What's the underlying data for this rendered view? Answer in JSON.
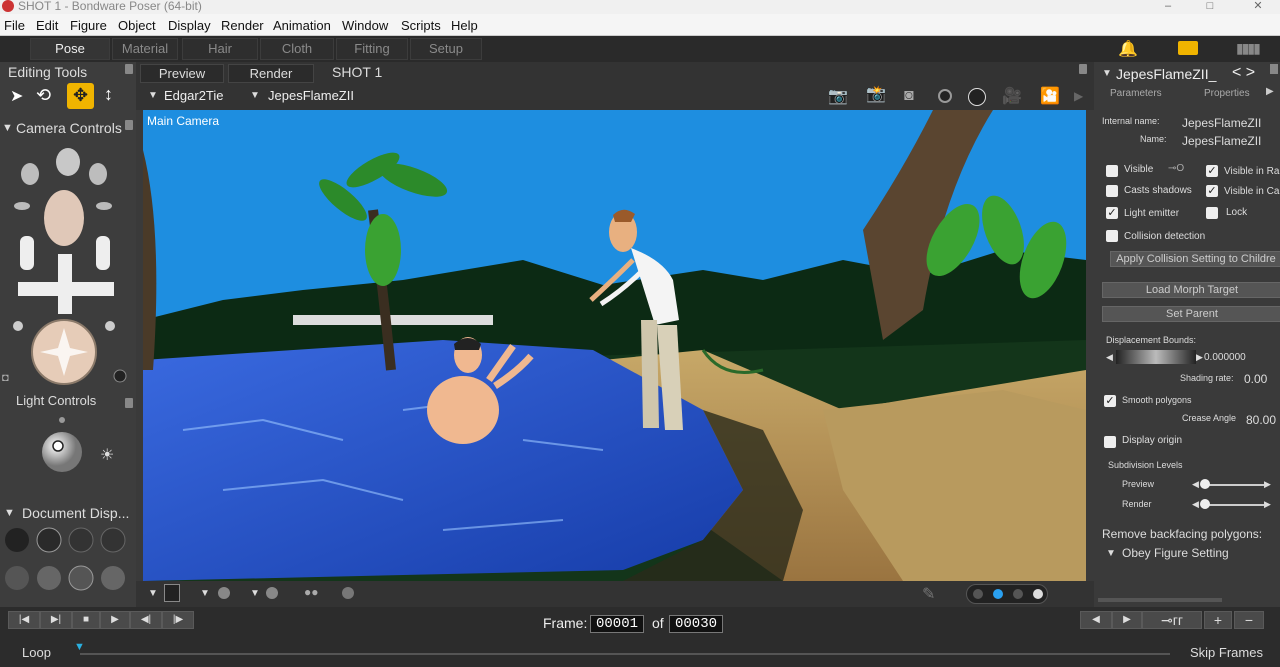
{
  "window": {
    "title": "SHOT 1 - Bondware Poser (64-bit)"
  },
  "menu": [
    "File",
    "Edit",
    "Figure",
    "Object",
    "Display",
    "Render",
    "Animation",
    "Window",
    "Scripts",
    "Help"
  ],
  "rooms": [
    "Pose",
    "Material",
    "Hair",
    "Cloth",
    "Fitting",
    "Setup"
  ],
  "left": {
    "editing_tools": "Editing Tools",
    "camera_controls": "Camera Controls",
    "light_controls": "Light Controls",
    "document_display": "Document  Disp..."
  },
  "viewport": {
    "tabs": [
      "Preview",
      "Render"
    ],
    "shot": "SHOT 1",
    "figure_select": "Edgar2Tie",
    "actor_select": "JepesFlameZII",
    "camera_label": "Main Camera"
  },
  "right": {
    "title": "JepesFlameZII_",
    "tabs": [
      "Parameters",
      "Properties"
    ],
    "internal_name_label": "Internal name:",
    "internal_name": "JepesFlameZII",
    "name_label": "Name:",
    "name": "JepesFlameZII",
    "visible": "Visible",
    "visible_in_raytracing": "Visible in Ra",
    "casts_shadows": "Casts shadows",
    "visible_in_camera": "Visible in Ca",
    "light_emitter": "Light emitter",
    "lock": "Lock",
    "collision_detection": "Collision detection",
    "apply_collision": "Apply Collision Setting to Childre",
    "load_morph": "Load Morph Target",
    "set_parent": "Set Parent",
    "displacement_bounds": "Displacement Bounds:",
    "displacement_value": "0.000000",
    "shading_rate_label": "Shading rate:",
    "shading_rate": "0.00",
    "smooth_polygons": "Smooth polygons",
    "crease_angle_label": "Crease Angle",
    "crease_angle": "80.00",
    "display_origin": "Display origin",
    "subdivision_levels": "Subdivision Levels",
    "preview": "Preview",
    "render": "Render",
    "remove_backfacing": "Remove backfacing polygons:",
    "obey_figure": "Obey Figure Setting"
  },
  "timeline": {
    "frame_label": "Frame:",
    "frame": "00001",
    "of": "of",
    "total": "00030",
    "loop": "Loop",
    "skip_frames": "Skip Frames"
  },
  "colors": {
    "accent": "#f0b400",
    "sky": "#1e8ee0",
    "water": "#1f4fc0"
  }
}
